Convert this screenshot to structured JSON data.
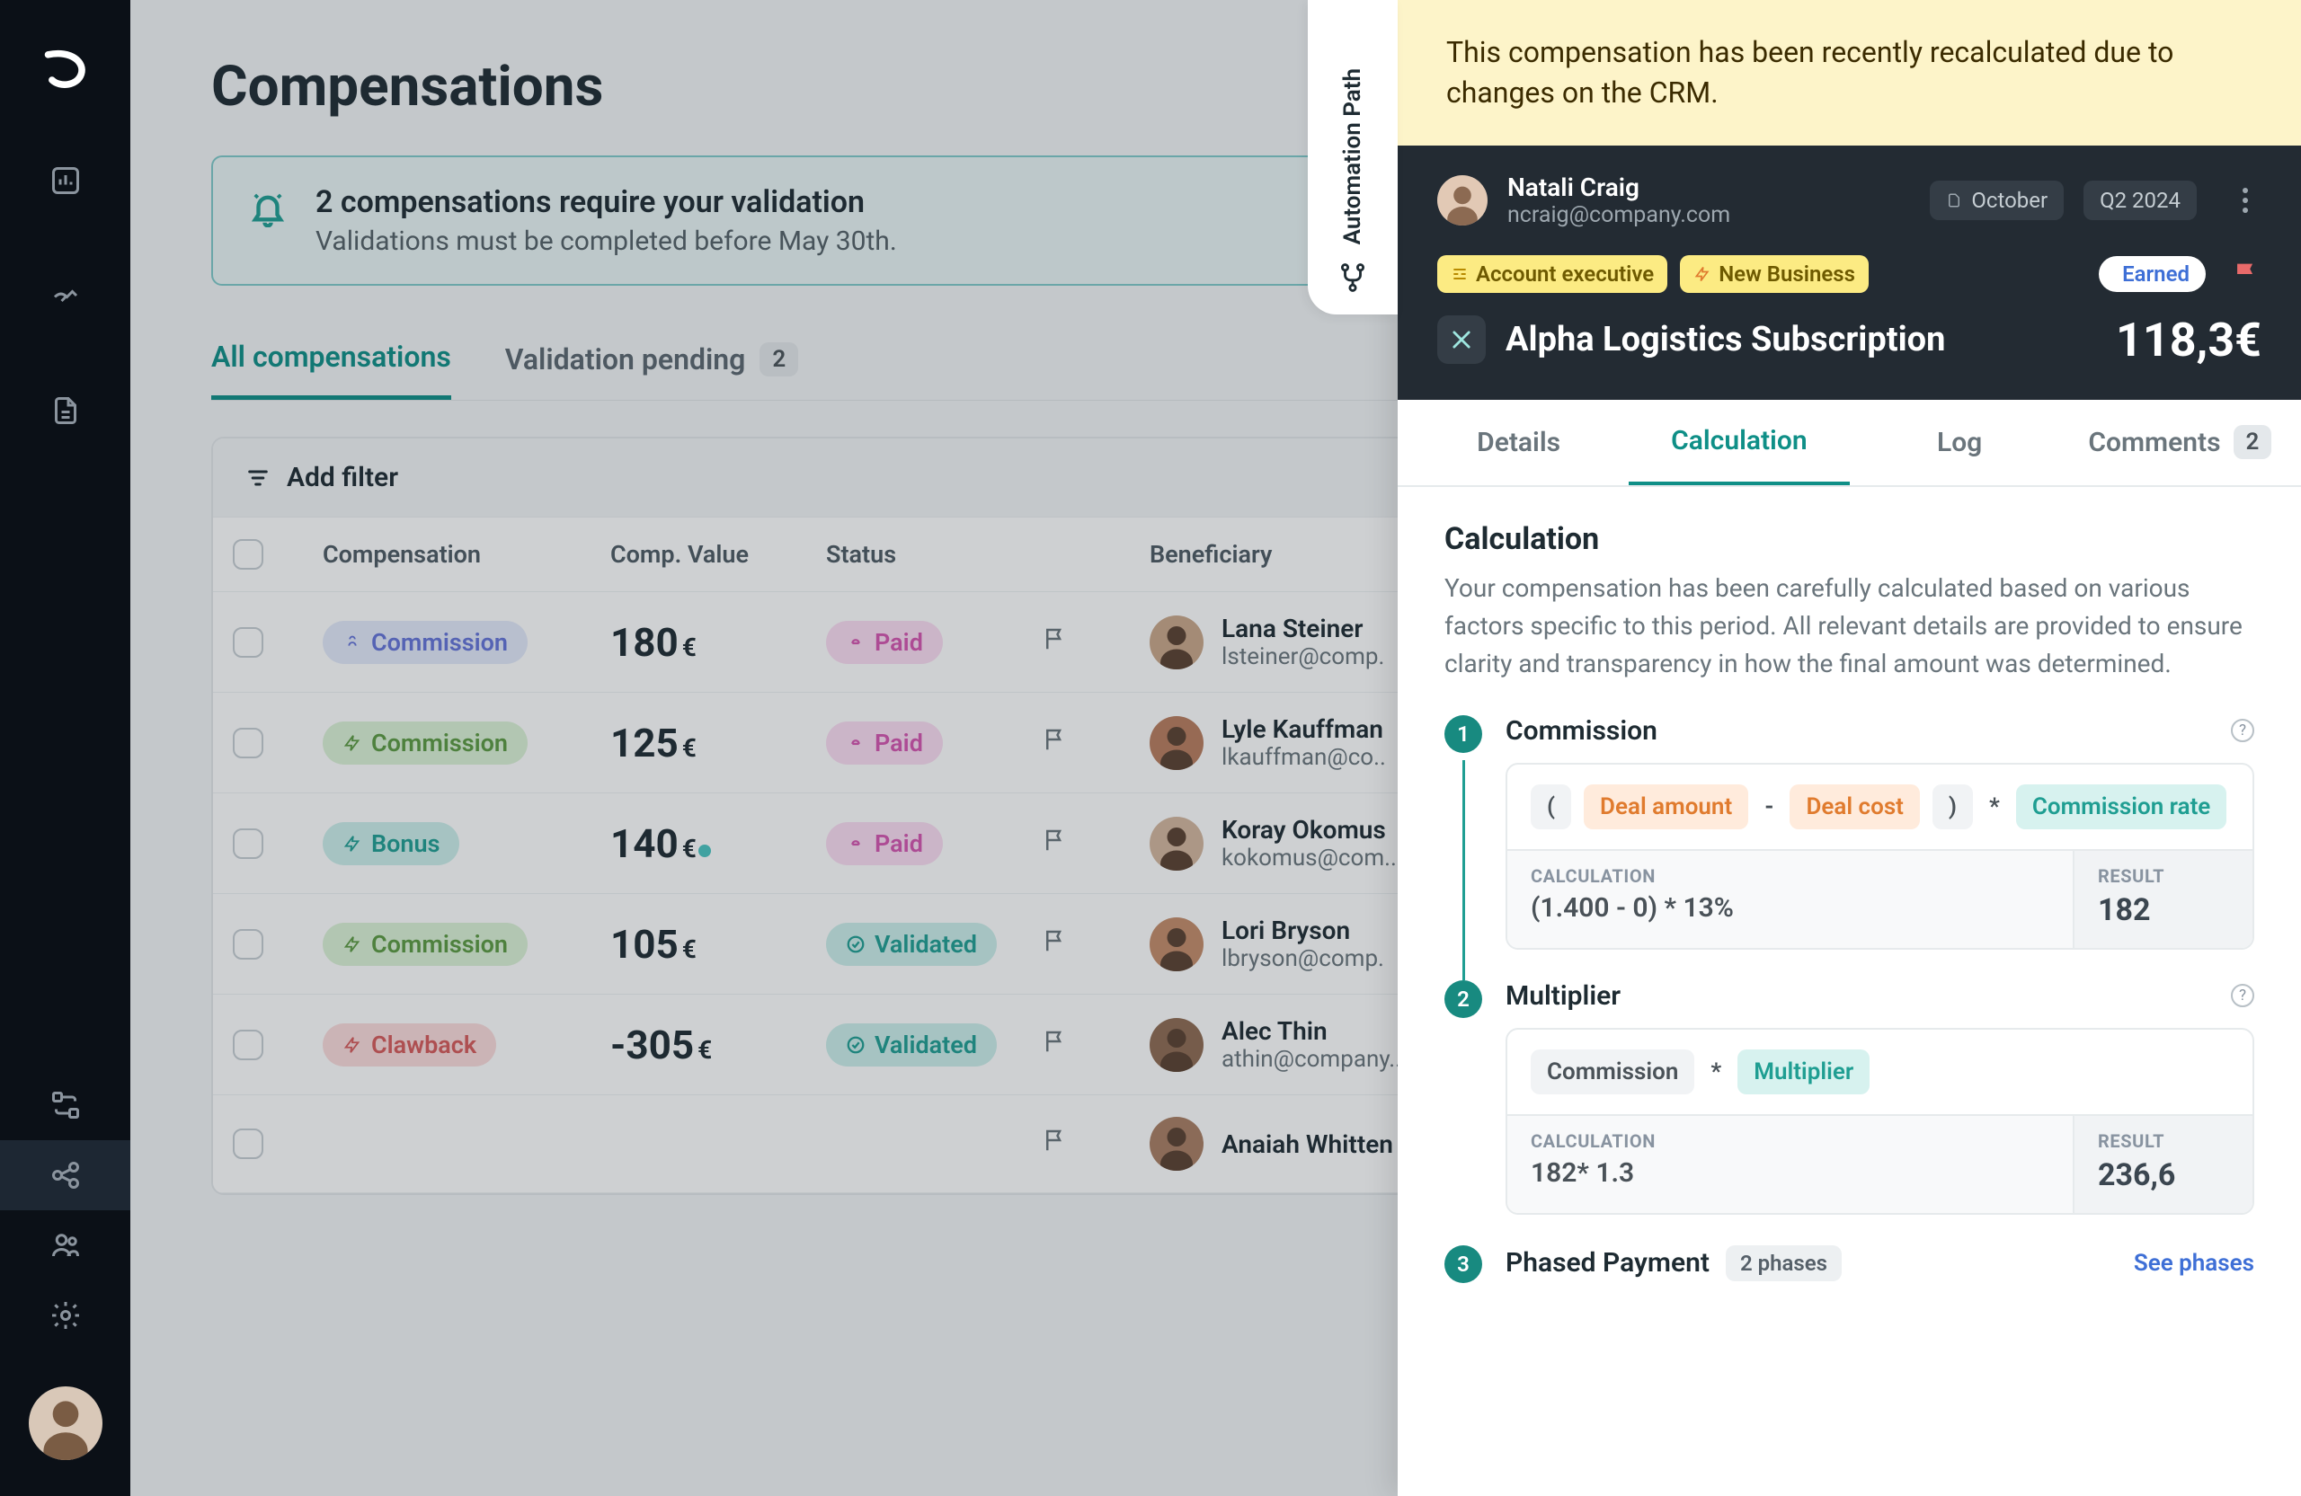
{
  "page_title": "Compensations",
  "alert": {
    "title": "2 compensations require your validation",
    "subtitle": "Validations must be completed before May 30th."
  },
  "main_tabs": {
    "all": "All compensations",
    "pending": "Validation pending",
    "pending_count": "2"
  },
  "filter_label": "Add filter",
  "table_head": {
    "comp": "Compensation",
    "value": "Comp. Value",
    "status": "Status",
    "beneficiary": "Beneficiary"
  },
  "rows": [
    {
      "type": "Commission",
      "type_style": "blue",
      "value": "180",
      "cur": "€",
      "status": "Paid",
      "status_style": "pink",
      "name": "Lana Steiner",
      "email": "lsteiner@comp."
    },
    {
      "type": "Commission",
      "type_style": "green",
      "value": "125",
      "cur": "€",
      "status": "Paid",
      "status_style": "pink",
      "name": "Lyle Kauffman",
      "email": "lkauffman@co.."
    },
    {
      "type": "Bonus",
      "type_style": "teal",
      "value": "140",
      "cur": "€",
      "status": "Paid",
      "status_style": "pink",
      "name": "Koray Okomus",
      "email": "kokomus@com.."
    },
    {
      "type": "Commission",
      "type_style": "green",
      "value": "105",
      "cur": "€",
      "status": "Validated",
      "status_style": "val",
      "name": "Lori Bryson",
      "email": "lbryson@comp."
    },
    {
      "type": "Clawback",
      "type_style": "red",
      "value": "-305",
      "cur": "€",
      "status": "Validated",
      "status_style": "val",
      "name": "Alec Thin",
      "email": "athin@company.."
    },
    {
      "type": "",
      "type_style": "",
      "value": "",
      "cur": "",
      "status": "",
      "status_style": "",
      "name": "Anaiah Whitten",
      "email": ""
    }
  ],
  "auto_tab_label": "Automation Path",
  "banner": "This compensation has been recently recalculated due to changes on the CRM.",
  "user": {
    "name": "Natali Craig",
    "email": "ncraig@company.com"
  },
  "chip_month": "October",
  "chip_quarter": "Q2 2024",
  "tags": {
    "role": "Account executive",
    "biz": "New Business",
    "earned": "Earned"
  },
  "deal": {
    "title": "Alpha Logistics Subscription",
    "amount": "118,3€"
  },
  "panel_tabs": {
    "details": "Details",
    "calculation": "Calculation",
    "log": "Log",
    "comments": "Comments",
    "comments_count": "2"
  },
  "calc_section": {
    "heading": "Calculation",
    "desc": "Your compensation has been carefully calculated based on various factors specific to this period. All relevant details are provided to ensure clarity and transparency in how the final amount was determined."
  },
  "steps": [
    {
      "num": "1",
      "title": "Commission",
      "formula": [
        {
          "t": "(",
          "s": "gray"
        },
        {
          "t": "Deal amount",
          "s": "orange"
        },
        {
          "t": "-",
          "s": "plain"
        },
        {
          "t": "Deal cost",
          "s": "orange"
        },
        {
          "t": ")",
          "s": "gray"
        },
        {
          "t": "*",
          "s": "plain"
        },
        {
          "t": "Commission rate",
          "s": "teal"
        }
      ],
      "calc_label": "CALCULATION",
      "calc_value": "(1.400 - 0) * 13%",
      "res_label": "RESULT",
      "res_value": "182"
    },
    {
      "num": "2",
      "title": "Multiplier",
      "formula": [
        {
          "t": "Commission",
          "s": "gray"
        },
        {
          "t": "*",
          "s": "plain"
        },
        {
          "t": "Multiplier",
          "s": "teal"
        }
      ],
      "calc_label": "CALCULATION",
      "calc_value": "182* 1.3",
      "res_label": "RESULT",
      "res_value": "236,6"
    }
  ],
  "step3": {
    "num": "3",
    "title": "Phased Payment",
    "phases": "2 phases",
    "see": "See phases"
  },
  "colors": {
    "accent": "#0F8F87"
  }
}
